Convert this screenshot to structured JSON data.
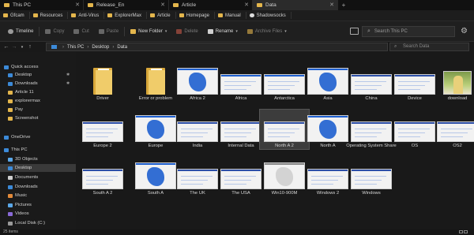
{
  "tabs": [
    {
      "label": "This PC",
      "active": false
    },
    {
      "label": "Release_En",
      "active": false
    },
    {
      "label": "Article",
      "active": false
    },
    {
      "label": "Data",
      "active": true
    }
  ],
  "tab_add_label": "+",
  "tab_close_label": "✕",
  "favorites": [
    {
      "label": "Gfcam",
      "icon": "folder-icon"
    },
    {
      "label": "Resources",
      "icon": "folder-icon"
    },
    {
      "label": "Anti-Virus",
      "icon": "folder-icon"
    },
    {
      "label": "ExplorerMax",
      "icon": "folder-icon"
    },
    {
      "label": "Article",
      "icon": "folder-icon"
    },
    {
      "label": "Homepage",
      "icon": "folder-icon"
    },
    {
      "label": "Manual",
      "icon": "folder-icon"
    },
    {
      "label": "Shadowsocks",
      "icon": "gear-icon"
    }
  ],
  "toolbar": {
    "timeline": "Timeline",
    "copy": "Copy",
    "cut": "Cut",
    "paste": "Paste",
    "new_folder": "New Folder",
    "delete": "Delete",
    "rename": "Rename",
    "archive_files": "Archive Files",
    "search_placeholder": "Search This PC",
    "caret": "▾"
  },
  "nav": {
    "back": "←",
    "forward": "→",
    "up": "↑",
    "path": [
      "This PC",
      "Desktop",
      "Data"
    ],
    "separator": "›",
    "search_placeholder": "Search Data"
  },
  "sidebar": {
    "items": [
      {
        "label": "Quick access",
        "icon": "star-icon",
        "pinned": false,
        "selected": false
      },
      {
        "label": "Desktop",
        "icon": "desktop-icon",
        "pinned": true,
        "selected": false
      },
      {
        "label": "Downloads",
        "icon": "download-icon",
        "pinned": true,
        "selected": false
      },
      {
        "label": "Article 11",
        "icon": "folder-icon",
        "pinned": false,
        "selected": false
      },
      {
        "label": "explorermax",
        "icon": "folder-icon",
        "pinned": false,
        "selected": false
      },
      {
        "label": "Pay",
        "icon": "folder-icon",
        "pinned": false,
        "selected": false
      },
      {
        "label": "Screenshot",
        "icon": "folder-icon",
        "pinned": false,
        "selected": false
      },
      {
        "label": "OneDrive",
        "icon": "cloud-icon",
        "pinned": false,
        "selected": false
      },
      {
        "label": "This PC",
        "icon": "computer-icon",
        "pinned": false,
        "selected": false
      },
      {
        "label": "3D Objects",
        "icon": "cube-icon",
        "pinned": false,
        "selected": false
      },
      {
        "label": "Desktop",
        "icon": "desktop-icon",
        "pinned": false,
        "selected": true
      },
      {
        "label": "Documents",
        "icon": "document-icon",
        "pinned": false,
        "selected": false
      },
      {
        "label": "Downloads",
        "icon": "download-icon",
        "pinned": false,
        "selected": false
      },
      {
        "label": "Music",
        "icon": "music-icon",
        "pinned": false,
        "selected": false
      },
      {
        "label": "Pictures",
        "icon": "picture-icon",
        "pinned": false,
        "selected": false
      },
      {
        "label": "Videos",
        "icon": "video-icon",
        "pinned": false,
        "selected": false
      },
      {
        "label": "Local Disk (C:)",
        "icon": "disk-icon",
        "pinned": false,
        "selected": false
      }
    ],
    "pin_glyph": "✱"
  },
  "files": [
    {
      "label": "Driver",
      "kind": "folder"
    },
    {
      "label": "Error or problem",
      "kind": "folder"
    },
    {
      "label": "Africa 2",
      "kind": "image",
      "accent": "#1e5fcf"
    },
    {
      "label": "Africa",
      "kind": "image",
      "accent": "#1e5fcf"
    },
    {
      "label": "Antarctica",
      "kind": "image",
      "accent": "#1e5fcf"
    },
    {
      "label": "Asia",
      "kind": "image",
      "accent": "#1e5fcf"
    },
    {
      "label": "China",
      "kind": "image",
      "accent": "#2d4fa8"
    },
    {
      "label": "Device",
      "kind": "image",
      "accent": "#2d4fa8"
    },
    {
      "label": "download",
      "kind": "photo"
    },
    {
      "label": "Europe 2",
      "kind": "image",
      "accent": "#2d4fa8"
    },
    {
      "label": "Europe",
      "kind": "image",
      "accent": "#1e5fcf"
    },
    {
      "label": "India",
      "kind": "image",
      "accent": "#2d4fa8"
    },
    {
      "label": "Internal Data",
      "kind": "image",
      "accent": "#2d4fa8"
    },
    {
      "label": "North A 2",
      "kind": "image",
      "accent": "#2d4fa8",
      "selected": true
    },
    {
      "label": "North A",
      "kind": "image",
      "accent": "#1e5fcf"
    },
    {
      "label": "Operating System Share",
      "kind": "image",
      "accent": "#2d4fa8"
    },
    {
      "label": "OS",
      "kind": "image",
      "accent": "#2d4fa8"
    },
    {
      "label": "OS2",
      "kind": "image",
      "accent": "#2d4fa8"
    },
    {
      "label": "South A 2",
      "kind": "image",
      "accent": "#2d4fa8"
    },
    {
      "label": "South A",
      "kind": "image",
      "accent": "#1e5fcf"
    },
    {
      "label": "The UK",
      "kind": "image",
      "accent": "#2d4fa8"
    },
    {
      "label": "The USA",
      "kind": "image",
      "accent": "#2d4fa8"
    },
    {
      "label": "Win10-900M",
      "kind": "image",
      "accent": "#888888"
    },
    {
      "label": "Windows 2",
      "kind": "image",
      "accent": "#2d4fa8"
    },
    {
      "label": "Windows",
      "kind": "image",
      "accent": "#2d4fa8"
    }
  ],
  "status": {
    "count": "25 items"
  },
  "colors": {
    "background": "#191919",
    "folder": "#f0cc6a",
    "accent_blue": "#3c8ad8",
    "selected": "#3c3c3c"
  }
}
